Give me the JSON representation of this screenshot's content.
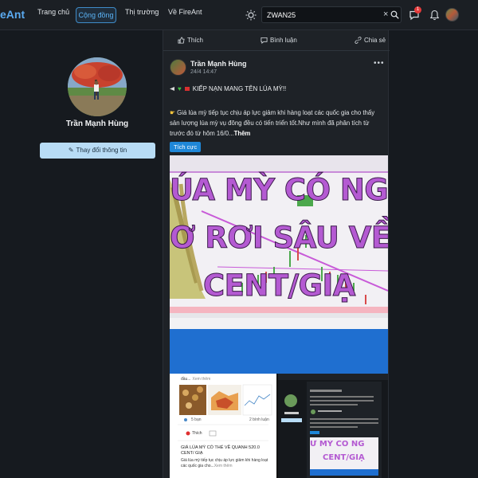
{
  "header": {
    "brand": "eAnt",
    "nav": [
      "Trang chủ",
      "Cộng đồng",
      "Thị trường",
      "Về FireAnt"
    ],
    "active_nav": "Cộng đồng",
    "search_value": "ZWAN25",
    "notification_count": "1"
  },
  "profile": {
    "name": "Trần Mạnh Hùng",
    "edit_label": "Thay đổi thông tin"
  },
  "post_actions": {
    "like": "Thích",
    "comment": "Bình luận",
    "share": "Chia sẻ"
  },
  "post": {
    "author": "Trần Mạnh Hùng",
    "time": "24/4 14:47",
    "title": "KIẾP NẠN MANG TÊN LÚA MỲ!!",
    "body": "Giá lúa mỳ tiếp tục chịu áp lực giảm khi hàng loạt các quốc gia cho thấy sản lượng lúa mỳ vụ đông đều có tiến triển tốt.Như mình đã phân tích từ trước đó từ hôm 16/0...",
    "more": "Thêm",
    "tag": "Tích cực"
  },
  "image": {
    "headline_line1": "ÚA MỲ CÓ NG",
    "headline_line2": "Ơ RƠI SÂU VỀ",
    "headline_line3": "CENT/GIẠ"
  },
  "thumbnail": {
    "caption_top": "đầu...",
    "caption_top_more": "Xem thêm",
    "likes": "5 bạn",
    "comments": "2 bình luận",
    "like": "Thích",
    "headline": "GIÁ LÚA MỲ CÓ THỂ VỀ QUANH 520.0 CENT/ GIẠ",
    "body": "Giá lúa mỳ tiếp tục chịu áp lực giảm khi hàng loạt các quốc gia cho...",
    "body_more": "Xem thêm",
    "mini_headline_1": "Ừ MỲ CÓ NG",
    "mini_headline_2": "CENT/GIẠ"
  },
  "colors": {
    "accent": "#1f87d8",
    "headline_purple": "#b45ad2",
    "edit_button": "#b8dcf5"
  }
}
